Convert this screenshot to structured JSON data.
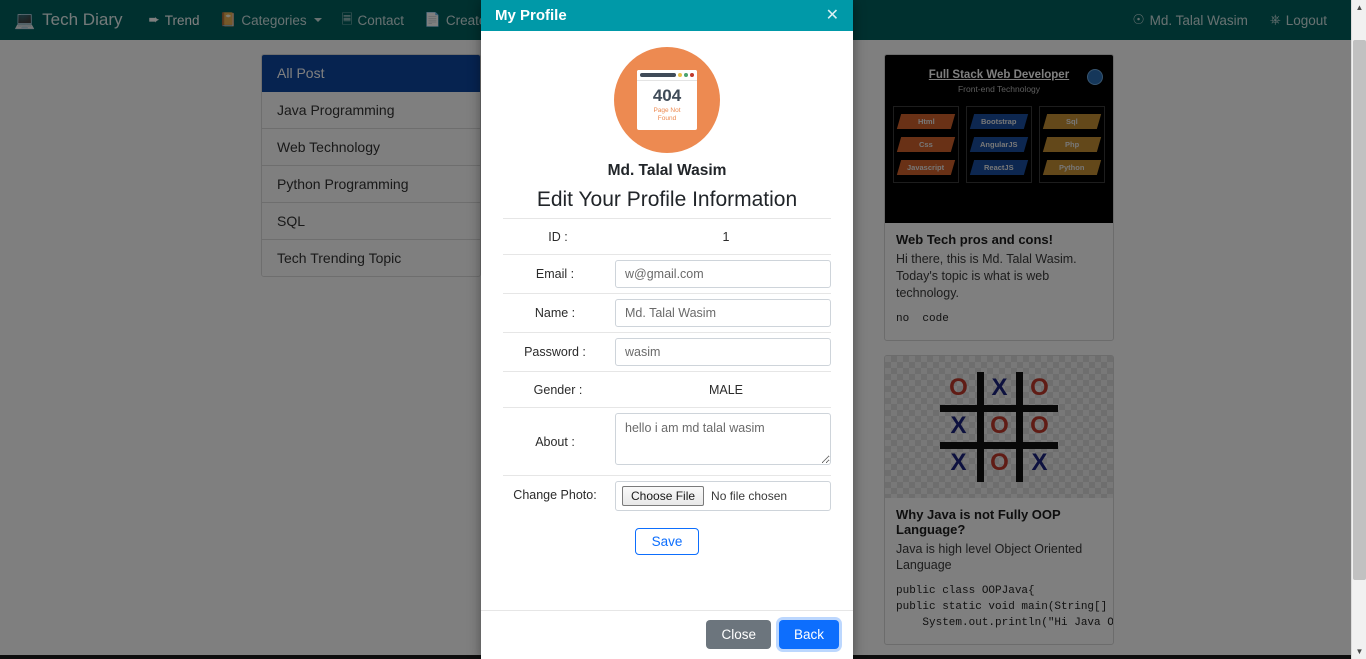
{
  "navbar": {
    "brand": "Tech Diary",
    "brand_icon": "laptop-icon",
    "links": [
      {
        "label": "Trend",
        "icon": "paper-plane-icon",
        "active": true
      },
      {
        "label": "Categories",
        "icon": "book-icon",
        "active": false,
        "caret": true
      },
      {
        "label": "Contact",
        "icon": "address-book-icon",
        "active": false
      },
      {
        "label": "Create Post",
        "icon": "id-card-icon",
        "active": false
      }
    ],
    "user": {
      "label": "Md. Talal Wasim",
      "icon": "user-circle-icon"
    },
    "logout": {
      "label": "Logout",
      "icon": "power-off-icon"
    }
  },
  "sidebar": {
    "items": [
      {
        "label": "All Post",
        "active": true
      },
      {
        "label": "Java Programming",
        "active": false
      },
      {
        "label": "Web Technology",
        "active": false
      },
      {
        "label": "Python Programming",
        "active": false
      },
      {
        "label": "SQL",
        "active": false
      },
      {
        "label": "Tech Trending Topic",
        "active": false
      }
    ]
  },
  "posts": [
    {
      "image": {
        "title": "Full Stack Web Developer",
        "subtitle": "Front-end Technology",
        "columns": [
          {
            "color": "#d2622c",
            "items": [
              "Html",
              "Css",
              "Javascript"
            ]
          },
          {
            "color": "#1a4fa0",
            "items": [
              "Bootstrap",
              "AngularJS",
              "ReactJS"
            ]
          },
          {
            "color": "#c79135",
            "items": [
              "Sql",
              "Php",
              "Python"
            ]
          }
        ]
      },
      "title": "Web Tech pros and cons!",
      "text": "Hi there, this is Md. Talal Wasim. Today's topic is what is web technology.",
      "code": "no  code"
    },
    {
      "image": {
        "alt": "tic-tac-toe-board",
        "cells": [
          "O",
          "X",
          "O",
          "X",
          "O",
          "O",
          "X",
          "O",
          "X"
        ]
      },
      "title": "Why Java is not Fully OOP Language?",
      "text": "Java is high level Object Oriented Language",
      "code": "public class OOPJava{\npublic static void main(String[] args\n    System.out.println(\"Hi Java OOP\");"
    }
  ],
  "modal": {
    "title": "My Profile",
    "close_icon": "close-icon",
    "avatar": {
      "code": "404",
      "caption_line1": "Page Not",
      "caption_line2": "Found",
      "color": "#ed8a51"
    },
    "user_name": "Md. Talal Wasim",
    "heading": "Edit Your Profile Information",
    "fields": {
      "id_label": "ID :",
      "id_value": "1",
      "email_label": "Email :",
      "email_value": "w@gmail.com",
      "name_label": "Name :",
      "name_value": "Md. Talal Wasim",
      "password_label": "Password :",
      "password_value": "wasim",
      "gender_label": "Gender :",
      "gender_value": "MALE",
      "about_label": "About :",
      "about_value": "hello i am md talal wasim",
      "photo_label": "Change Photo:",
      "photo_button": "Choose File",
      "photo_status": "No file chosen"
    },
    "save_label": "Save",
    "close_label": "Close",
    "back_label": "Back"
  },
  "colors": {
    "navbar": "#00605f",
    "modal_header": "#0099a8",
    "active_sidebar": "#0d47a1",
    "primary_button": "#0d6efd",
    "secondary_button": "#6c757d",
    "avatar": "#ed8a51"
  }
}
